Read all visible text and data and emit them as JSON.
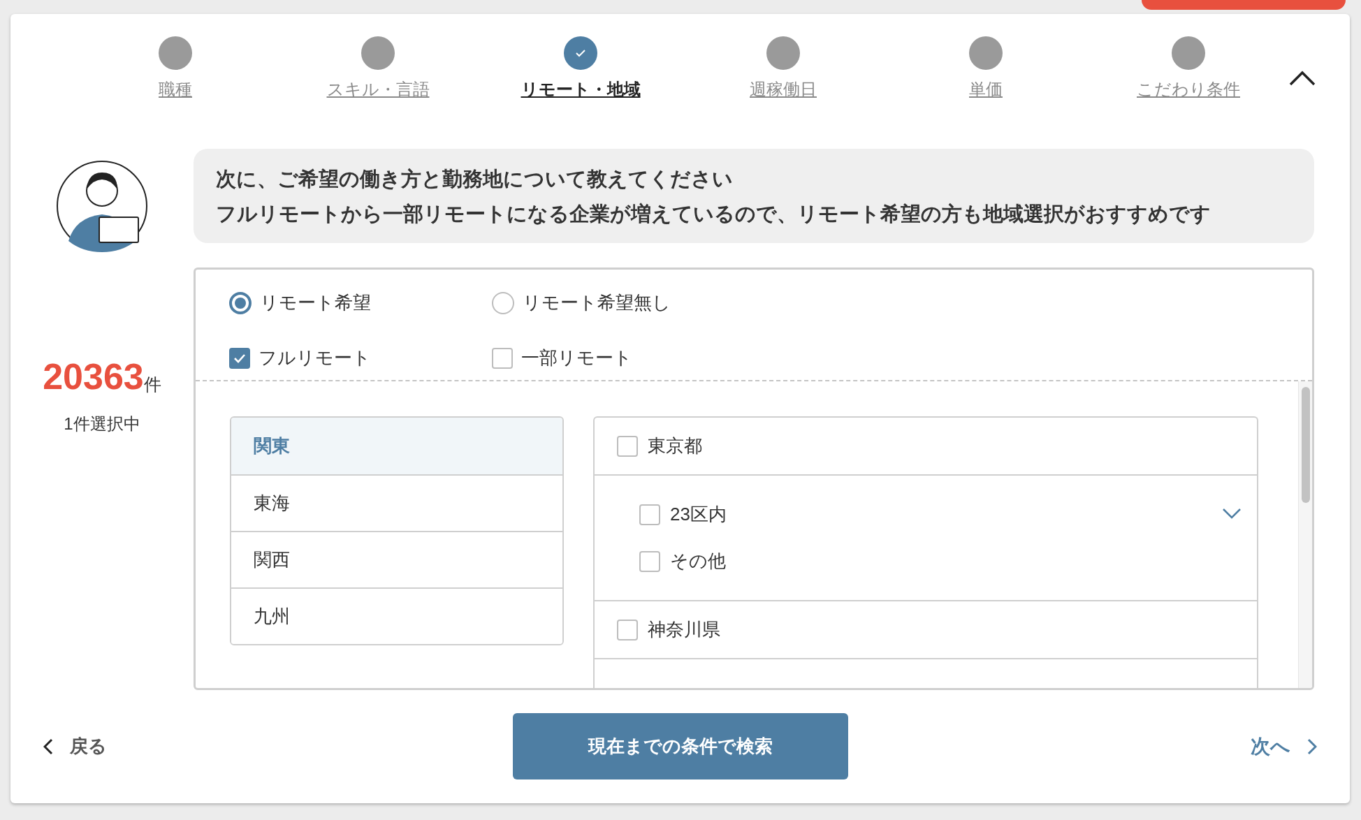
{
  "steps": [
    {
      "label": "職種",
      "selected": false
    },
    {
      "label": "スキル・言語",
      "selected": false
    },
    {
      "label": "リモート・地域",
      "selected": true
    },
    {
      "label": "週稼働日",
      "selected": false
    },
    {
      "label": "単価",
      "selected": false
    },
    {
      "label": "こだわり条件",
      "selected": false
    }
  ],
  "guide": {
    "lines": [
      "次に、ご希望の働き方と勤務地について教えてください",
      "フルリモートから一部リモートになる企業が増えているので、リモート希望の方も地域選択がおすすめです"
    ]
  },
  "count": {
    "value": "20363",
    "unit": "件",
    "selected_text": "1件選択中"
  },
  "remote_options": [
    {
      "label": "リモート希望",
      "selected": true
    },
    {
      "label": "リモート希望無し",
      "selected": false
    }
  ],
  "remote_types": [
    {
      "label": "フルリモート",
      "checked": true
    },
    {
      "label": "一部リモート",
      "checked": false
    }
  ],
  "regions": [
    {
      "label": "関東",
      "selected": true
    },
    {
      "label": "東海",
      "selected": false
    },
    {
      "label": "関西",
      "selected": false
    },
    {
      "label": "九州",
      "selected": false
    }
  ],
  "prefectures": [
    {
      "label": "東京都",
      "checked": false,
      "expanded": true,
      "children": [
        {
          "label": "23区内",
          "checked": false
        },
        {
          "label": "その他",
          "checked": false
        }
      ]
    },
    {
      "label": "神奈川県",
      "checked": false
    }
  ],
  "footer": {
    "back": "戻る",
    "search": "現在までの条件で検索",
    "next": "次へ"
  }
}
